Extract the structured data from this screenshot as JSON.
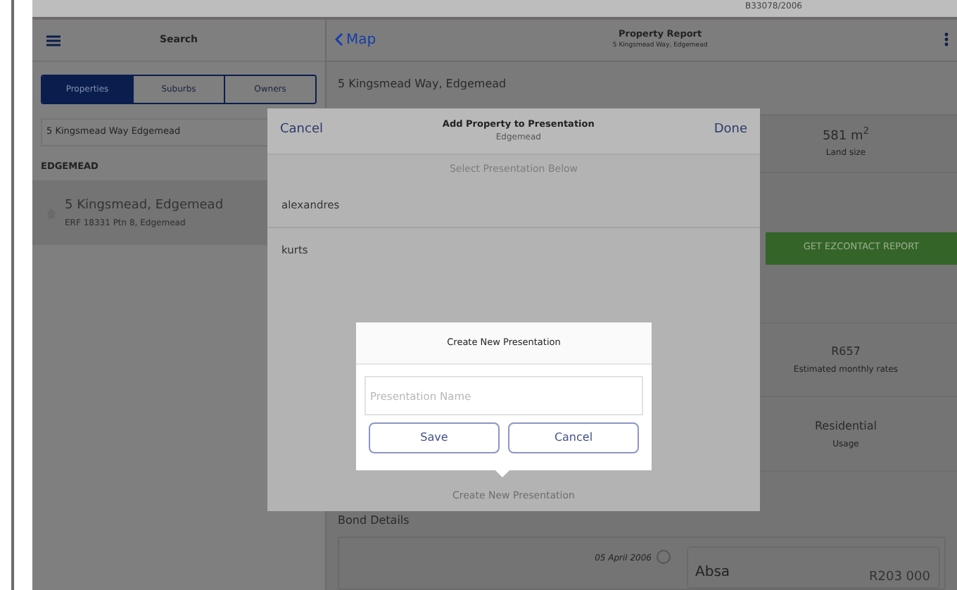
{
  "previous_strip": {
    "text": "B33078/2006"
  },
  "sidebar": {
    "title": "Search",
    "segments": [
      {
        "label": "Properties",
        "selected": true
      },
      {
        "label": "Suburbs",
        "selected": false
      },
      {
        "label": "Owners",
        "selected": false
      }
    ],
    "search": {
      "value": "5 Kingsmead Way Edgemead"
    },
    "section": "EDGEMEAD",
    "results": [
      {
        "title": "5 Kingsmead, Edgemead",
        "subtitle": "ERF 18331 Ptn 8, Edgemead"
      }
    ]
  },
  "report": {
    "back": "Map",
    "title": "Property Report",
    "subtitle": "5 Kingsmead Way, Edgemead",
    "address": "5 Kingsmead Way, Edgemead",
    "land": {
      "value": "581 m$^{2}$",
      "label": "Land size"
    },
    "contact_button": "GET EZCONTACT REPORT",
    "stats": [
      {
        "value": "R657",
        "label": "Estimated monthly rates"
      },
      {
        "value": "Residential",
        "label": "Usage"
      }
    ],
    "bond_title": "Bond Details",
    "bonds": [
      {
        "date": "05 April 2006",
        "bank": "Absa",
        "amount": "R203 000"
      }
    ]
  },
  "modal": {
    "cancel": "Cancel",
    "title": "Add Property to Presentation",
    "subtitle": "Edgemead",
    "done": "Done",
    "prompt": "Select Presentation Below",
    "items": [
      "alexandres",
      "kurts"
    ],
    "footer": "Create New Presentation"
  },
  "popup": {
    "title": "Create New Presentation",
    "placeholder": "Presentation Name",
    "buttons": [
      "Save",
      "Cancel"
    ]
  }
}
